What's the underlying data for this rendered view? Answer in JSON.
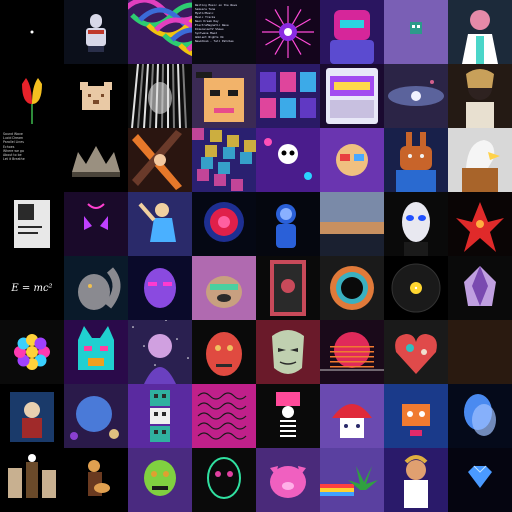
{
  "page": {
    "title": ""
  },
  "tiles": [
    {
      "name": "tile-01",
      "kind": "tiny-mark",
      "bg": "#000000",
      "text": "",
      "c": [
        "#ffffff"
      ]
    },
    {
      "name": "tile-02",
      "kind": "figure",
      "bg": "#0b0f1a",
      "text": "",
      "c": [
        "#d8d8e8",
        "#c0392b",
        "#2a2f4a"
      ]
    },
    {
      "name": "tile-03",
      "kind": "graffiti",
      "bg": "#3a1a5e",
      "text": "",
      "c": [
        "#e23fbf",
        "#2ecc71",
        "#3b6bd8",
        "#f1c40f"
      ]
    },
    {
      "name": "tile-04",
      "kind": "text-list",
      "bg": "#0a0a12",
      "text": "Waiting Music on the Wave\nSamsara Tone\nMysticMusic\nMusic Tracks\nNeon Dream Ray\nElectroMagnetic Wave\nDimensionTV Shows\nSyntwave Mood\nAmbient Nights Ok\nNewAlbum - Tell Patches",
      "c": [
        "#e84a9a",
        "#ffffff"
      ]
    },
    {
      "name": "tile-05",
      "kind": "star-burst",
      "bg": "#14051c",
      "text": "",
      "c": [
        "#ff4bd8",
        "#8a2be2",
        "#ffffff"
      ]
    },
    {
      "name": "tile-06",
      "kind": "robot",
      "bg": "#2a1560",
      "text": "",
      "c": [
        "#d6269a",
        "#5b4bd0",
        "#2bd3e0"
      ]
    },
    {
      "name": "tile-07",
      "kind": "pixel-ghost",
      "bg": "#7a5fb5",
      "text": "",
      "c": [
        "#2c9a8a",
        "#ffffff"
      ]
    },
    {
      "name": "tile-08",
      "kind": "character",
      "bg": "#1c2a3a",
      "text": "",
      "c": [
        "#e58aa8",
        "#ffffff",
        "#4ad6c9"
      ]
    },
    {
      "name": "tile-09",
      "kind": "tulip",
      "bg": "#000000",
      "text": "",
      "c": [
        "#e8222a",
        "#f5c020",
        "#2e8b3a"
      ]
    },
    {
      "name": "tile-10",
      "kind": "pixel-bear",
      "bg": "#000000",
      "text": "",
      "c": [
        "#e9c9a5",
        "#7a4a2a"
      ]
    },
    {
      "name": "tile-11",
      "kind": "statue",
      "bg": "#0c0c0c",
      "text": "",
      "c": [
        "#e0e0e0",
        "#7a7a7a"
      ]
    },
    {
      "name": "tile-12",
      "kind": "pixel-face",
      "bg": "#3b2a55",
      "text": "",
      "c": [
        "#f2b36a",
        "#1c1c1c",
        "#e84c8b"
      ]
    },
    {
      "name": "tile-13",
      "kind": "retro-screens",
      "bg": "#2a1a66",
      "text": "",
      "c": [
        "#6a3fd4",
        "#ff4da6",
        "#40c4ff"
      ]
    },
    {
      "name": "tile-14",
      "kind": "trading-card",
      "bg": "#1a0a30",
      "text": "",
      "c": [
        "#a24bf0",
        "#ffd84a",
        "#e8e8f8"
      ]
    },
    {
      "name": "tile-15",
      "kind": "galaxy",
      "bg": "#2b2446",
      "text": "",
      "c": [
        "#7c8dd6",
        "#f2f2ff",
        "#d45f8c"
      ]
    },
    {
      "name": "tile-16",
      "kind": "portrait",
      "bg": "#241a14",
      "text": "",
      "c": [
        "#c8a05a",
        "#2e2220",
        "#e8e0d0"
      ]
    },
    {
      "name": "tile-17",
      "kind": "text-list-small",
      "bg": "#000000",
      "text": "Sound Wave\nLucid Dream\nParallel Lines\nEchoes\nWhere we go\nAbout to be\nLet it Breathe",
      "c": [
        "#cfcfcf"
      ]
    },
    {
      "name": "tile-18",
      "kind": "crown",
      "bg": "#000000",
      "text": "",
      "c": [
        "#9a9080",
        "#4a443a"
      ]
    },
    {
      "name": "tile-19",
      "kind": "x-shape",
      "bg": "#2a1510",
      "text": "",
      "c": [
        "#e6782a",
        "#6a3a2a",
        "#f2c8a0"
      ]
    },
    {
      "name": "tile-20",
      "kind": "collage",
      "bg": "#2a2070",
      "text": "",
      "c": [
        "#e84fa2",
        "#f5d233",
        "#3ac1e0"
      ]
    },
    {
      "name": "tile-21",
      "kind": "skull-orbs",
      "bg": "#4a1c8c",
      "text": "",
      "c": [
        "#ffffff",
        "#ff4fb8",
        "#2ad4ff"
      ]
    },
    {
      "name": "tile-22",
      "kind": "glasses-guy",
      "bg": "#6a35b0",
      "text": "",
      "c": [
        "#f0c080",
        "#e84040",
        "#4aa8ff"
      ]
    },
    {
      "name": "tile-23",
      "kind": "mech-bunny",
      "bg": "#18204a",
      "text": "",
      "c": [
        "#c8642a",
        "#2a6ad0",
        "#f2f2f2"
      ]
    },
    {
      "name": "tile-24",
      "kind": "eagle",
      "bg": "#d8d8d8",
      "text": "",
      "c": [
        "#f5f5f5",
        "#a8642a",
        "#2a2a2a",
        "#ffd24a"
      ]
    },
    {
      "name": "tile-25",
      "kind": "card",
      "bg": "#000000",
      "text": "",
      "c": [
        "#e8e8e8",
        "#2a2a2a"
      ]
    },
    {
      "name": "tile-26",
      "kind": "neon-demon",
      "bg": "#1a0a2a",
      "text": "",
      "c": [
        "#c040ff",
        "#ff40d0"
      ]
    },
    {
      "name": "tile-27",
      "kind": "dancer",
      "bg": "#2a2a6a",
      "text": "",
      "c": [
        "#f0d0a0",
        "#2a2a2a",
        "#4ab0ff"
      ]
    },
    {
      "name": "tile-28",
      "kind": "nebula",
      "bg": "#050814",
      "text": "",
      "c": [
        "#e0204a",
        "#2a40c8",
        "#ff60a0"
      ]
    },
    {
      "name": "tile-29",
      "kind": "astronaut",
      "bg": "#05070f",
      "text": "",
      "c": [
        "#2a60d8",
        "#8ab0ff"
      ]
    },
    {
      "name": "tile-30",
      "kind": "sky",
      "bg": "#2a3448",
      "text": "",
      "c": [
        "#7a8aa8",
        "#c89060",
        "#1a2030"
      ]
    },
    {
      "name": "tile-31",
      "kind": "mask",
      "bg": "#0a0a0a",
      "text": "",
      "c": [
        "#e8e8f0",
        "#2050ff",
        "#1a1a1a"
      ]
    },
    {
      "name": "tile-32",
      "kind": "red-figure",
      "bg": "#0a0505",
      "text": "",
      "c": [
        "#e02a2a",
        "#ffae40"
      ]
    },
    {
      "name": "tile-33",
      "kind": "formula",
      "bg": "#000000",
      "text": "E = mc²",
      "c": [
        "#ffffff"
      ]
    },
    {
      "name": "tile-34",
      "kind": "squirrel",
      "bg": "#0a1a2a",
      "text": "",
      "c": [
        "#8a8a90",
        "#2a2a30",
        "#f0c050"
      ]
    },
    {
      "name": "tile-35",
      "kind": "purple-head",
      "bg": "#0a0a2a",
      "text": "",
      "c": [
        "#8a4ae0",
        "#ff3ad0"
      ]
    },
    {
      "name": "tile-36",
      "kind": "pug",
      "bg": "#b06ab0",
      "text": "",
      "c": [
        "#c8a080",
        "#2a2a2a",
        "#4ad0a0"
      ]
    },
    {
      "name": "tile-37",
      "kind": "tarot",
      "bg": "#0a0a0a",
      "text": "",
      "c": [
        "#c84a5a",
        "#2a2a2a"
      ]
    },
    {
      "name": "tile-38",
      "kind": "ring",
      "bg": "#1a1a1a",
      "text": "",
      "c": [
        "#e07a3a",
        "#3ab0c0",
        "#0a0a0a"
      ]
    },
    {
      "name": "tile-39",
      "kind": "record",
      "bg": "#000000",
      "text": "",
      "c": [
        "#1a1a1a",
        "#ffd630",
        "#ffffff"
      ]
    },
    {
      "name": "tile-40",
      "kind": "crystal-face",
      "bg": "#0a0a0a",
      "text": "",
      "c": [
        "#c0a0e0",
        "#7a4ab0"
      ]
    },
    {
      "name": "tile-41",
      "kind": "mandala",
      "bg": "#0a0a0a",
      "text": "",
      "c": [
        "#ff3ab0",
        "#3ad0ff",
        "#ffd23a",
        "#a040ff"
      ]
    },
    {
      "name": "tile-42",
      "kind": "cat-neon",
      "bg": "#2a0a4a",
      "text": "",
      "c": [
        "#20d0d0",
        "#ff40a0",
        "#f0a020"
      ]
    },
    {
      "name": "tile-43",
      "kind": "space-diva",
      "bg": "#2a2050",
      "text": "",
      "c": [
        "#d0a0e0",
        "#6a40c0",
        "#ffffff"
      ]
    },
    {
      "name": "tile-44",
      "kind": "red-face",
      "bg": "#0a0a0a",
      "text": "",
      "c": [
        "#e04a40",
        "#f0c060",
        "#2a2a2a"
      ]
    },
    {
      "name": "tile-45",
      "kind": "anonymous",
      "bg": "#6a1a2a",
      "text": "",
      "c": [
        "#c0d0b0",
        "#2a2a2a"
      ]
    },
    {
      "name": "tile-46",
      "kind": "synth-sun",
      "bg": "#1a0a1a",
      "text": "",
      "c": [
        "#e02a5a",
        "#f07a30",
        "#ffffff"
      ]
    },
    {
      "name": "tile-47",
      "kind": "heart-art",
      "bg": "#1a1a1a",
      "text": "",
      "c": [
        "#e04a4a",
        "#30c0c0",
        "#f0e0d0"
      ]
    },
    {
      "name": "tile-48",
      "kind": "placeholder",
      "bg": "#2a1a10",
      "text": "",
      "c": [
        "#000000"
      ]
    },
    {
      "name": "tile-49",
      "kind": "framed-girl",
      "bg": "#000000",
      "text": "",
      "c": [
        "#1a3a6a",
        "#e8d0b0",
        "#a02a2a"
      ]
    },
    {
      "name": "tile-50",
      "kind": "planet-rocks",
      "bg": "#2a1a4a",
      "text": "",
      "c": [
        "#4a7ad8",
        "#e0c080",
        "#8a40d0"
      ]
    },
    {
      "name": "tile-51",
      "kind": "totem",
      "bg": "#5a2aa0",
      "text": "",
      "c": [
        "#30b0a0",
        "#f0f0f0",
        "#2a2a2a"
      ]
    },
    {
      "name": "tile-52",
      "kind": "handwriting",
      "bg": "#c0208a",
      "text": "",
      "c": [
        "#1a1a1a"
      ]
    },
    {
      "name": "tile-53",
      "kind": "skeleton",
      "bg": "#0a0a0a",
      "text": "",
      "c": [
        "#ff4a9a",
        "#ffffff"
      ]
    },
    {
      "name": "tile-54",
      "kind": "red-mushroom",
      "bg": "#6a4ab0",
      "text": "",
      "c": [
        "#e02a3a",
        "#ffffff",
        "#2a2a6a"
      ]
    },
    {
      "name": "tile-55",
      "kind": "robot-box",
      "bg": "#1a3a8a",
      "text": "",
      "c": [
        "#f07a30",
        "#e02a6a",
        "#ffffff"
      ]
    },
    {
      "name": "tile-56",
      "kind": "heads",
      "bg": "#050a1a",
      "text": "",
      "c": [
        "#4a8af0",
        "#a0c0ff"
      ]
    },
    {
      "name": "tile-57",
      "kind": "warriors",
      "bg": "#000000",
      "text": "",
      "c": [
        "#c8b090",
        "#6a4a2a",
        "#ffffff"
      ]
    },
    {
      "name": "tile-58",
      "kind": "guitarist",
      "bg": "#000000",
      "text": "",
      "c": [
        "#e0a050",
        "#6a3a20"
      ]
    },
    {
      "name": "tile-59",
      "kind": "zombie",
      "bg": "#4a2a80",
      "text": "",
      "c": [
        "#80d040",
        "#e0a030",
        "#1a1a1a"
      ]
    },
    {
      "name": "tile-60",
      "kind": "green-outline",
      "bg": "#0a0a0a",
      "text": "",
      "c": [
        "#30e0a0",
        "#e040a0"
      ]
    },
    {
      "name": "tile-61",
      "kind": "pink-pig",
      "bg": "#4a2a7a",
      "text": "",
      "c": [
        "#f060c0",
        "#ffb0e8"
      ]
    },
    {
      "name": "tile-62",
      "kind": "nyan-leaf",
      "bg": "#5a40a0",
      "text": "",
      "c": [
        "#30a040",
        "#ff4040",
        "#ffd030",
        "#40a0ff"
      ]
    },
    {
      "name": "tile-63",
      "kind": "cartoon-guy",
      "bg": "#2a1a6a",
      "text": "",
      "c": [
        "#e0a070",
        "#ffffff",
        "#d0d0f0"
      ]
    },
    {
      "name": "tile-64",
      "kind": "diamond",
      "bg": "#050510",
      "text": "",
      "c": [
        "#4a9aff",
        "#c0e0ff"
      ]
    }
  ]
}
